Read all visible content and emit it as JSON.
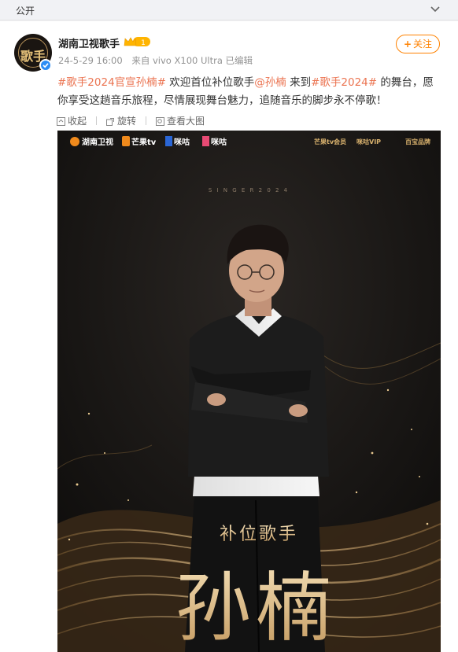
{
  "topbar": {
    "label": "公开",
    "toggle_icon": "chevron-down-icon"
  },
  "post": {
    "author": "湖南卫视歌手",
    "level_badge": "1",
    "timestamp": "24-5-29 16:00",
    "source": "来自 vivo X100 Ultra",
    "edited": "已编辑",
    "follow_label": "关注",
    "follow_plus": "+",
    "text": {
      "tag1": "#歌手2024官宣孙楠#",
      "part1": " 欢迎首位补位歌手",
      "mention": "@孙楠",
      "part2": " 来到",
      "tag2": "#歌手2024#",
      "part3": " 的舞台，愿你享受这趟音乐旅程，尽情展现舞台魅力，追随音乐的脚步永不停歌！"
    },
    "tools": {
      "collapse": "收起",
      "rotate": "旋转",
      "view_large": "查看大图"
    },
    "colors": {
      "link": "#eb7350",
      "follow": "#ff8200",
      "verified": "#2c8cf4"
    }
  },
  "avatar_text": "歌手",
  "poster": {
    "logos_left": [
      "湖南卫视",
      "芒果tv",
      "咪咕",
      "咪咕"
    ],
    "logos_right": [
      "芒果tv会员",
      "咪咕VIP",
      "百宝品牌"
    ],
    "tagline": "S I N G E R   2 0 2 4",
    "subtitle": "补位歌手",
    "name": "孙楠"
  }
}
